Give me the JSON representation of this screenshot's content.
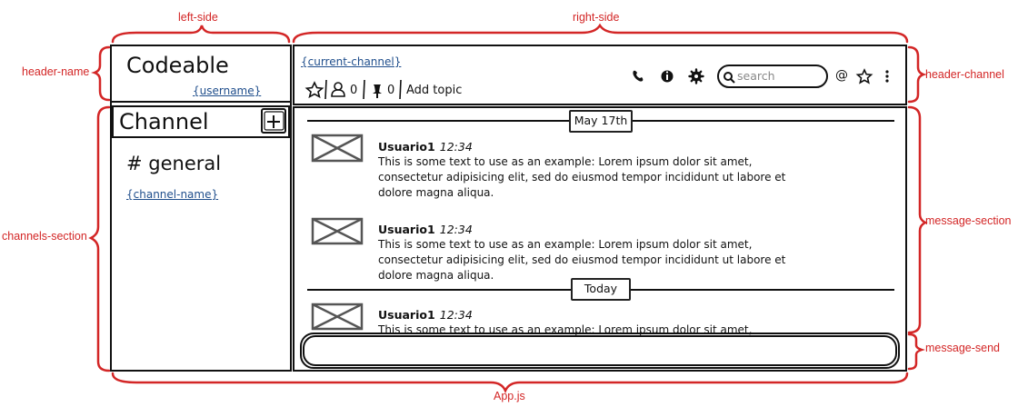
{
  "annotations": {
    "left_side": "left-side",
    "right_side": "right-side",
    "header_name": "header-name",
    "channels_section": "channels-section",
    "header_channel": "header-channel",
    "message_section": "message-section",
    "message_send": "message-send",
    "app": "App.js"
  },
  "header_name": {
    "app_title": "Codeable",
    "username": "{username}"
  },
  "header_channel": {
    "current_channel": "{current-channel}",
    "members_count": "0",
    "pins_count": "0",
    "add_topic": "Add topic",
    "search_placeholder": "search",
    "at_symbol": "@",
    "icons": [
      "star-icon",
      "user-icon",
      "pin-icon",
      "phone-icon",
      "info-icon",
      "gear-icon",
      "search-icon",
      "star-icon",
      "more-vertical-icon"
    ]
  },
  "channels": {
    "title": "Channel",
    "add_symbol": "+",
    "items": [
      {
        "label": "# general"
      },
      {
        "label": "{channel-name}"
      }
    ]
  },
  "messages": {
    "date_1": "May 17th",
    "date_2": "Today",
    "items": [
      {
        "user": "Usuario1",
        "time": "12:34",
        "text": " This is some text to use as an example: Lorem ipsum dolor sit amet, consectetur adipisicing elit, sed do eiusmod tempor incididunt ut labore et dolore magna aliqua."
      },
      {
        "user": "Usuario1",
        "time": "12:34",
        "text": " This is some text to use as an example: Lorem ipsum dolor sit amet, consectetur adipisicing elit, sed do eiusmod tempor incididunt ut labore et dolore magna aliqua."
      },
      {
        "user": "Usuario1",
        "time": "12:34",
        "text": " This is some text to use as an example: Lorem ipsum dolor sit amet,"
      }
    ]
  },
  "colors": {
    "annotation": "#d32626",
    "link": "#1f4e8c",
    "border": "#111111"
  }
}
